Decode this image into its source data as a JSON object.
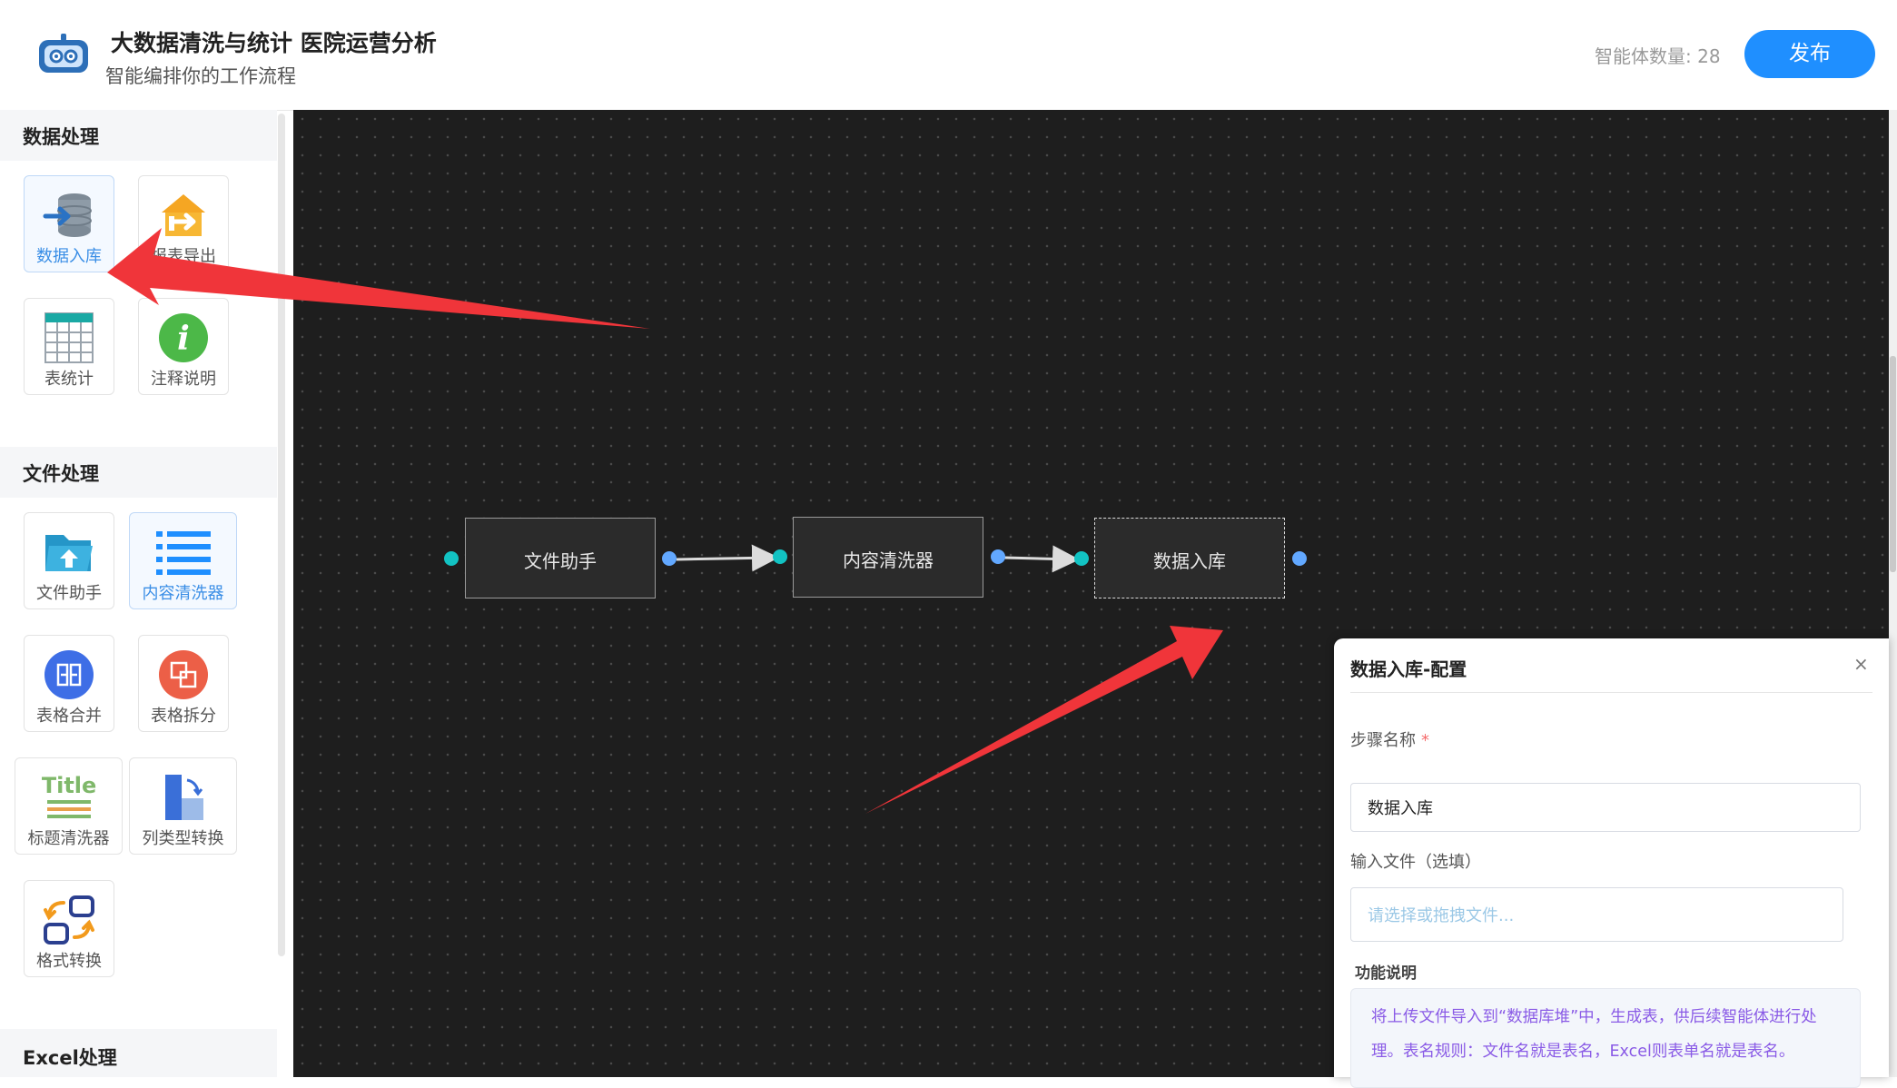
{
  "header": {
    "title": "大数据清洗与统计  医院运营分析",
    "subtitle": "智能编排你的工作流程",
    "agent_count": "智能体数量: 28",
    "publish_label": "发布"
  },
  "sidebar": {
    "categories": [
      {
        "title": "数据处理",
        "tools": [
          {
            "label": "数据入库",
            "icon": "database-import-icon"
          },
          {
            "label": "报表导出",
            "icon": "report-export-icon"
          },
          {
            "label": "表统计",
            "icon": "table-stats-icon"
          },
          {
            "label": "注释说明",
            "icon": "info-icon"
          }
        ]
      },
      {
        "title": "文件处理",
        "tools": [
          {
            "label": "文件助手",
            "icon": "folder-upload-icon"
          },
          {
            "label": "内容清洗器",
            "icon": "list-lines-icon"
          },
          {
            "label": "表格合并",
            "icon": "table-merge-icon"
          },
          {
            "label": "表格拆分",
            "icon": "table-split-icon"
          },
          {
            "label": "标题清洗器",
            "icon": "title-clean-icon"
          },
          {
            "label": "列类型转换",
            "icon": "column-convert-icon"
          },
          {
            "label": "格式转换",
            "icon": "format-convert-icon"
          }
        ]
      },
      {
        "title": "Excel处理",
        "tools": []
      }
    ]
  },
  "workflow": {
    "nodes": [
      {
        "label": "文件助手"
      },
      {
        "label": "内容清洗器"
      },
      {
        "label": "数据入库",
        "selected": true
      }
    ]
  },
  "config_panel": {
    "title": "数据入库-配置",
    "close_icon": "×",
    "step_name_label": "步骤名称",
    "required_mark": "*",
    "step_name_value": "数据入库",
    "input_file_label": "输入文件（选填）",
    "input_file_placeholder": "请选择或拖拽文件...",
    "description_label": "功能说明",
    "description_text": "将上传文件导入到“数据库堆”中，生成表，供后续智能体进行处理。表名规则：文件名就是表名，Excel则表单名就是表名。"
  },
  "colors": {
    "accent": "#1f8fff",
    "canvas": "#1e1e1e",
    "port_in": "#12c3c3",
    "port_out": "#62a8ff",
    "annotation_arrow": "#f0353a",
    "description_text": "#8a5be6"
  }
}
